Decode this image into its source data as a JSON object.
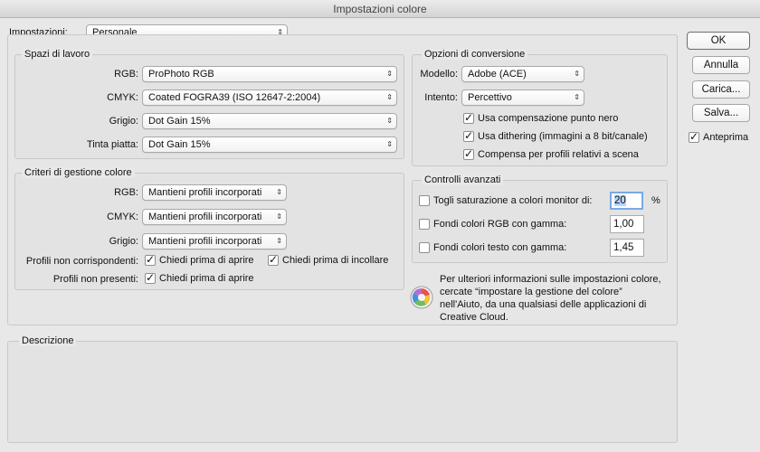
{
  "window": {
    "title": "Impostazioni colore"
  },
  "settings": {
    "label": "Impostazioni:",
    "value": "Personale"
  },
  "workspaces": {
    "title": "Spazi di lavoro",
    "rows": [
      {
        "label": "RGB:",
        "value": "ProPhoto RGB"
      },
      {
        "label": "CMYK:",
        "value": "Coated FOGRA39 (ISO 12647-2:2004)"
      },
      {
        "label": "Grigio:",
        "value": "Dot Gain 15%"
      },
      {
        "label": "Tinta piatta:",
        "value": "Dot Gain 15%"
      }
    ]
  },
  "policies": {
    "title": "Criteri di gestione colore",
    "rows": [
      {
        "label": "RGB:",
        "value": "Mantieni profili incorporati"
      },
      {
        "label": "CMYK:",
        "value": "Mantieni profili incorporati"
      },
      {
        "label": "Grigio:",
        "value": "Mantieni profili incorporati"
      }
    ],
    "mismatch_label": "Profili non corrispondenti:",
    "mismatch_open": "Chiedi prima di aprire",
    "mismatch_paste": "Chiedi prima di incollare",
    "missing_label": "Profili non presenti:",
    "missing_open": "Chiedi prima di aprire"
  },
  "conversion": {
    "title": "Opzioni di conversione",
    "engine_label": "Modello:",
    "engine_value": "Adobe (ACE)",
    "intent_label": "Intento:",
    "intent_value": "Percettivo",
    "bpc": "Usa compensazione punto nero",
    "dither": "Usa dithering (immagini a 8 bit/canale)",
    "scene": "Compensa per profili relativi a scena"
  },
  "advanced": {
    "title": "Controlli avanzati",
    "desaturate_label": "Togli saturazione a colori monitor di:",
    "desaturate_value": "20",
    "desaturate_unit": "%",
    "rgb_gamma_label": "Fondi colori RGB con gamma:",
    "rgb_gamma_value": "1,00",
    "text_gamma_label": "Fondi colori testo con gamma:",
    "text_gamma_value": "1,45"
  },
  "info": {
    "text_line1": "Per ulteriori informazioni sulle impostazioni colore,",
    "text_line2": "cercate “impostare la gestione del colore”",
    "text_line3": "nell'Aiuto, da una qualsiasi delle applicazioni di",
    "text_line4": "Creative Cloud."
  },
  "description": {
    "title": "Descrizione"
  },
  "buttons": {
    "ok": "OK",
    "cancel": "Annulla",
    "load": "Carica...",
    "save": "Salva...",
    "preview": "Anteprima"
  },
  "icons": {
    "select_arrows": "select-arrows-icon",
    "check": "checkmark-icon",
    "info": "color-wheel-icon"
  }
}
